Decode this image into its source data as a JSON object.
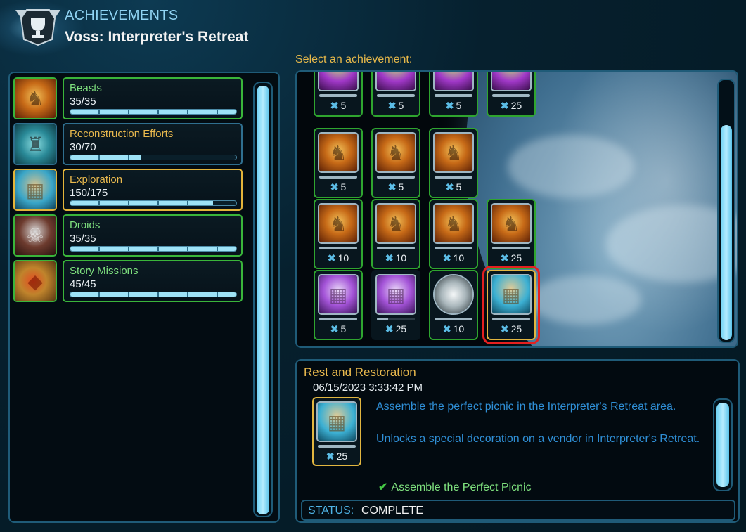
{
  "header": {
    "title": "ACHIEVEMENTS",
    "subtitle": "Voss: Interpreter's Retreat",
    "icon": "trophy-icon"
  },
  "grid": {
    "prompt": "Select an achievement:"
  },
  "categories": [
    {
      "name": "Beasts",
      "progress": "35/35",
      "fraction": 1.0,
      "state": "complete",
      "icon": "beast-statue-icon"
    },
    {
      "name": "Reconstruction Efforts",
      "progress": "30/70",
      "fraction": 0.43,
      "state": "incomplete",
      "icon": "droid-statue-icon"
    },
    {
      "name": "Exploration",
      "progress": "150/175",
      "fraction": 0.86,
      "state": "selected",
      "icon": "map-pedestal-icon"
    },
    {
      "name": "Droids",
      "progress": "35/35",
      "fraction": 1.0,
      "state": "complete",
      "icon": "droid-icon"
    },
    {
      "name": "Story Missions",
      "progress": "45/45",
      "fraction": 1.0,
      "state": "complete",
      "icon": "story-emblem-icon"
    }
  ],
  "achievements": [
    {
      "points": "5",
      "art": "green-purple",
      "complete": true
    },
    {
      "points": "5",
      "art": "green-purple",
      "complete": true
    },
    {
      "points": "5",
      "art": "green-purple",
      "complete": true
    },
    {
      "points": "25",
      "art": "green-purple",
      "complete": true
    },
    {
      "points": "5",
      "art": "beast",
      "complete": true
    },
    {
      "points": "5",
      "art": "beast",
      "complete": true
    },
    {
      "points": "5",
      "art": "beast",
      "complete": true
    },
    {
      "points": "10",
      "art": "beast",
      "complete": true
    },
    {
      "points": "10",
      "art": "beast",
      "complete": true
    },
    {
      "points": "10",
      "art": "beast",
      "complete": true
    },
    {
      "points": "25",
      "art": "beast",
      "complete": true
    },
    {
      "points": "5",
      "art": "purple-map",
      "complete": true
    },
    {
      "points": "25",
      "art": "purple-map",
      "complete": false
    },
    {
      "points": "10",
      "art": "silver",
      "complete": true
    },
    {
      "points": "25",
      "art": "map",
      "complete": true,
      "selected": true
    }
  ],
  "detail": {
    "title": "Rest and Restoration",
    "date": "06/15/2023 3:33:42 PM",
    "points": "25",
    "description_1": "Assemble the perfect picnic in the Interpreter's Retreat area.",
    "description_2": "Unlocks a special decoration on a vendor in Interpreter's Retreat.",
    "objective": "Assemble the Perfect Picnic",
    "status_label": "STATUS:",
    "status_value": "COMPLETE"
  },
  "colors": {
    "complete_border": "#3ab53a",
    "selected_border": "#e3b43a",
    "highlight_red": "#e52020",
    "title_gold": "#e8b84d",
    "desc_blue": "#2f8fd6"
  }
}
